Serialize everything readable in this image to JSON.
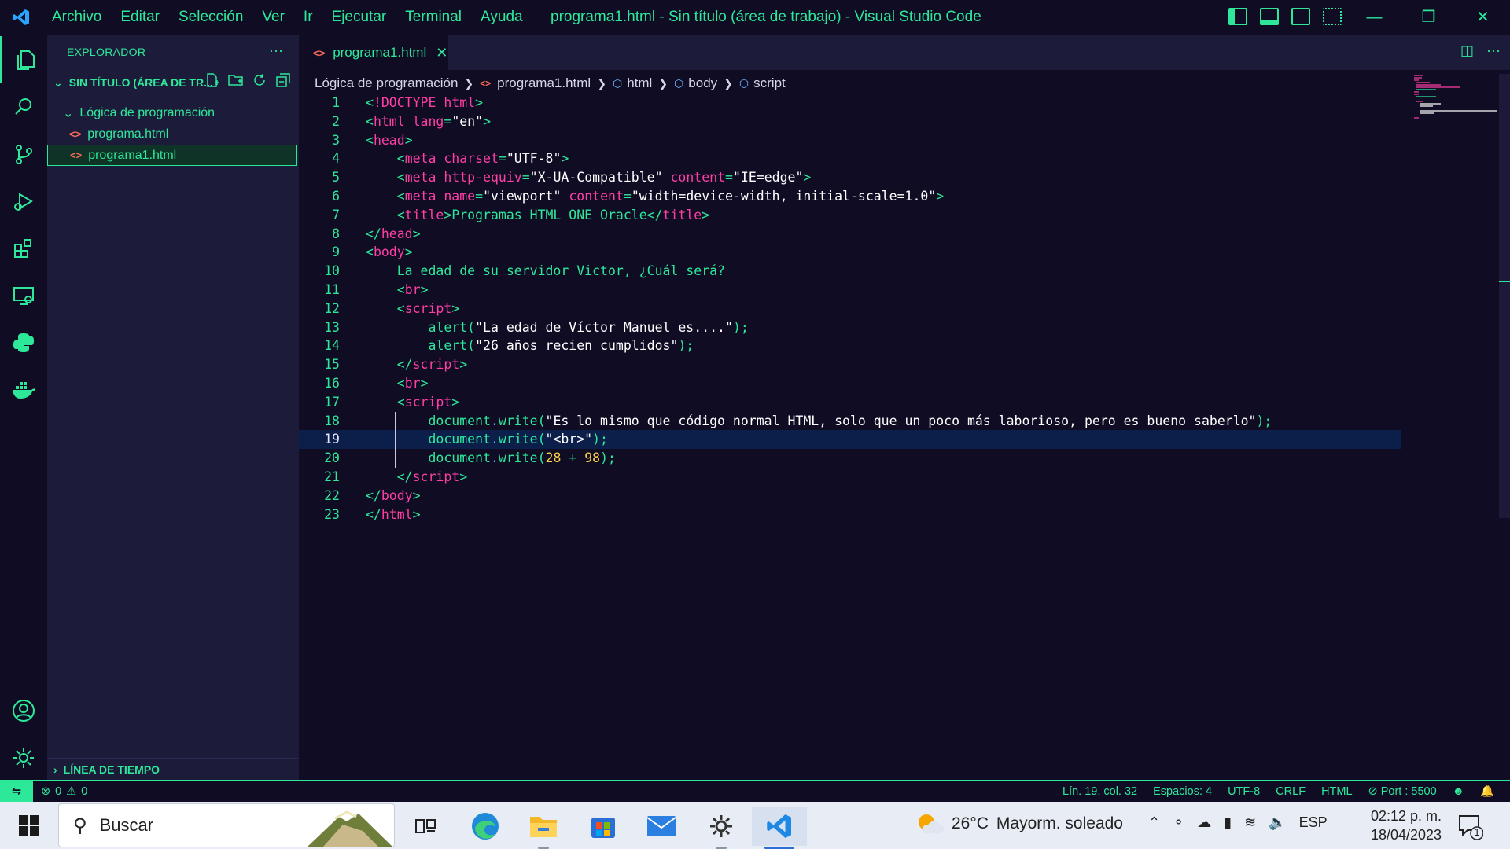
{
  "window": {
    "title": "programa1.html - Sin título (área de trabajo) - Visual Studio Code",
    "menu": [
      "Archivo",
      "Editar",
      "Selección",
      "Ver",
      "Ir",
      "Ejecutar",
      "Terminal",
      "Ayuda"
    ],
    "controls": [
      "minimize",
      "restore",
      "close"
    ]
  },
  "colors": {
    "accent": "#2ee89a",
    "pink": "#ff3fa4",
    "bg": "#0f0c24",
    "sidebar": "#1d1b3a"
  },
  "activity_bar": [
    "files-icon",
    "search-icon",
    "source-control-icon",
    "run-debug-icon",
    "extensions-icon",
    "remote-explorer-icon",
    "python-icon",
    "docker-icon",
    "account-icon",
    "settings-gear-icon"
  ],
  "sidebar": {
    "title": "EXPLORADOR",
    "more": "···",
    "workspace": "SIN TÍTULO (ÁREA DE TR...",
    "folder": "Lógica de programación",
    "files": [
      "programa.html",
      "programa1.html"
    ],
    "timeline": "LÍNEA DE TIEMPO"
  },
  "editor": {
    "tab": "programa1.html",
    "breadcrumb": [
      "Lógica de programación",
      "programa1.html",
      "html",
      "body",
      "script"
    ],
    "current_line": 19
  },
  "status": {
    "errors": "0",
    "warnings": "0",
    "position": "Lín. 19, col. 32",
    "spaces": "Espacios: 4",
    "encoding": "UTF-8",
    "eol": "CRLF",
    "language": "HTML",
    "port": "Port : 5500"
  },
  "taskbar": {
    "search_placeholder": "Buscar",
    "weather_temp": "26°C",
    "weather_desc": "Mayorm. soleado",
    "lang": "ESP",
    "time": "02:12 p. m.",
    "date": "18/04/2023",
    "notifications": "1"
  }
}
